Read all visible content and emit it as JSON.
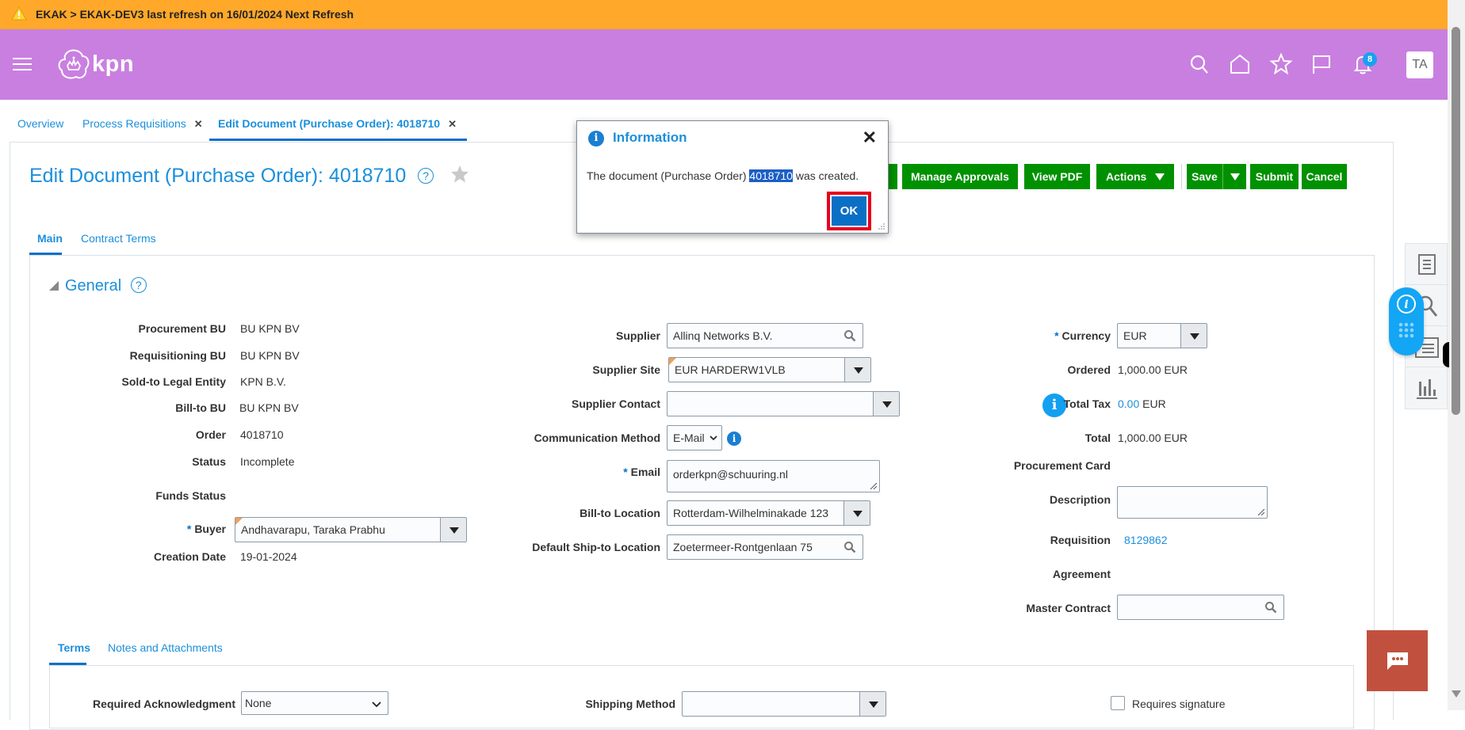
{
  "banner": {
    "text": "EKAK > EKAK-DEV3 last refresh on 16/01/2024 Next Refresh",
    "icon": "warning-icon",
    "color": "#ffa82a"
  },
  "header": {
    "brand": "kpn",
    "color": "#c97fe0",
    "icons": [
      "menu-icon",
      "search-icon",
      "home-icon",
      "favorites-star-icon",
      "watchlist-flag-icon",
      "notifications-bell-icon"
    ],
    "notifications_count": "8",
    "avatar_initials": "TA"
  },
  "page_tabs": [
    {
      "label": "Overview",
      "closable": false,
      "active": false
    },
    {
      "label": "Process Requisitions",
      "closable": true,
      "active": false
    },
    {
      "label": "Edit Document (Purchase Order): 4018710",
      "closable": true,
      "active": true
    }
  ],
  "page": {
    "title": "Edit Document (Purchase Order): 4018710",
    "help": "?",
    "toolbar": {
      "manage_approvals": "Manage Approvals",
      "view_pdf": "View PDF",
      "actions": "Actions",
      "save": "Save",
      "submit": "Submit",
      "cancel": "Cancel"
    },
    "tabs": [
      {
        "label": "Main",
        "active": true
      },
      {
        "label": "Contract Terms",
        "active": false
      }
    ],
    "section_title": "General"
  },
  "general": {
    "left": [
      {
        "label": "Procurement BU",
        "value": "BU KPN BV"
      },
      {
        "label": "Requisitioning BU",
        "value": "BU KPN BV"
      },
      {
        "label": "Sold-to Legal Entity",
        "value": "KPN B.V."
      },
      {
        "label": "Bill-to BU",
        "value": "BU KPN BV"
      },
      {
        "label": "Order",
        "value": "4018710"
      },
      {
        "label": "Status",
        "value": "Incomplete"
      },
      {
        "label": "Funds Status",
        "value": ""
      },
      {
        "label": "Buyer",
        "value": "Andhavarapu, Taraka Prabhu",
        "required": true
      },
      {
        "label": "Creation Date",
        "value": "19-01-2024"
      }
    ],
    "middle": {
      "supplier": {
        "label": "Supplier",
        "value": "Allinq Networks B.V."
      },
      "supplier_site": {
        "label": "Supplier Site",
        "value": "EUR HARDERW1VLB"
      },
      "supplier_contact": {
        "label": "Supplier Contact",
        "value": ""
      },
      "communication_method": {
        "label": "Communication Method",
        "value": "E-Mail"
      },
      "email": {
        "label": "Email",
        "value": "orderkpn@schuuring.nl",
        "required": true
      },
      "bill_to_location": {
        "label": "Bill-to Location",
        "value": "Rotterdam-Wilhelminakade 123"
      },
      "ship_to_location": {
        "label": "Default Ship-to Location",
        "value": "Zoetermeer-Rontgenlaan 75"
      }
    },
    "right": {
      "currency": {
        "label": "Currency",
        "value": "EUR",
        "required": true
      },
      "ordered": {
        "label": "Ordered",
        "amount": "1,000.00",
        "currency": "EUR"
      },
      "total_tax": {
        "label": "Total Tax",
        "amount": "0.00",
        "currency": "EUR"
      },
      "total": {
        "label": "Total",
        "amount": "1,000.00",
        "currency": "EUR"
      },
      "procurement_card": {
        "label": "Procurement Card",
        "value": ""
      },
      "description": {
        "label": "Description",
        "value": ""
      },
      "requisition": {
        "label": "Requisition",
        "value": "8129862"
      },
      "agreement": {
        "label": "Agreement",
        "value": ""
      },
      "master_contract": {
        "label": "Master Contract",
        "value": ""
      }
    }
  },
  "terms": {
    "tabs": [
      {
        "label": "Terms",
        "active": true
      },
      {
        "label": "Notes and Attachments",
        "active": false
      }
    ],
    "required_acknowledgment": {
      "label": "Required Acknowledgment",
      "value": "None"
    },
    "shipping_method": {
      "label": "Shipping Method",
      "value": ""
    },
    "requires_signature": {
      "label": "Requires signature",
      "checked": false
    }
  },
  "dialog": {
    "title": "Information",
    "message_before": "The document (Purchase Order) ",
    "message_highlight": "4018710",
    "message_after": " was created.",
    "ok": "OK",
    "close": "✕"
  },
  "colors": {
    "accent": "#1b8fdb",
    "button_green": "#009100",
    "ok_blue": "#0b6fc6",
    "highlight_red": "#e8001c",
    "chat": "#c1513e"
  }
}
